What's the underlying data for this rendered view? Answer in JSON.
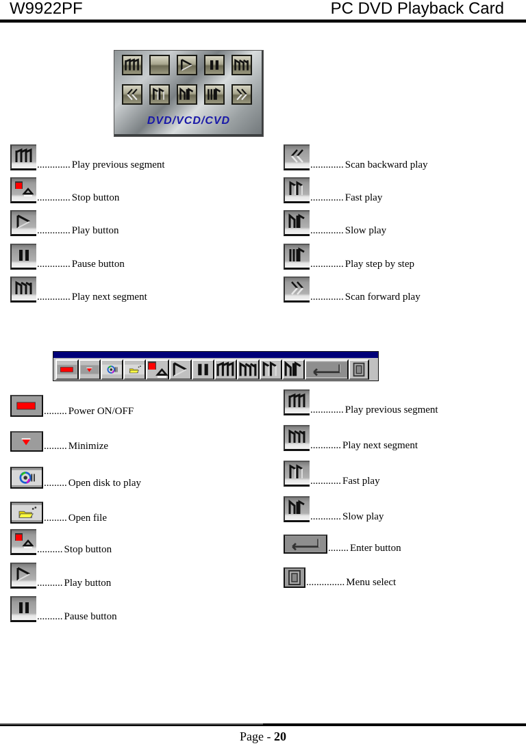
{
  "header": {
    "model": "W9922PF",
    "title": "PC DVD Playback Card"
  },
  "remote": {
    "label": "DVD/VCD/CVD",
    "buttons_row1": [
      "prev-segment-icon",
      "stop-eject-icon",
      "play-icon",
      "pause-icon",
      "next-segment-icon"
    ],
    "buttons_row2": [
      "scan-backward-icon",
      "fast-play-icon",
      "slow-play-icon",
      "step-play-icon",
      "scan-forward-icon"
    ]
  },
  "remote_legend": {
    "left": [
      {
        "icon": "prev-segment-icon",
        "dots": ".............",
        "label": "Play previous segment"
      },
      {
        "icon": "stop-icon",
        "dots": ".............",
        "label": "Stop button"
      },
      {
        "icon": "play-icon",
        "dots": ".............",
        "label": "Play button"
      },
      {
        "icon": "pause-icon",
        "dots": ".............",
        "label": "Pause button"
      },
      {
        "icon": "next-segment-icon",
        "dots": ".............",
        "label": "Play next segment"
      }
    ],
    "right": [
      {
        "icon": "scan-backward-icon",
        "dots": ".............",
        "label": "Scan backward play"
      },
      {
        "icon": "fast-play-icon",
        "dots": ".............",
        "label": "Fast play"
      },
      {
        "icon": "slow-play-icon",
        "dots": ".............",
        "label": "Slow play"
      },
      {
        "icon": "step-play-icon",
        "dots": ".............",
        "label": "Play step by step"
      },
      {
        "icon": "scan-forward-icon",
        "dots": ".............",
        "label": "Scan forward play"
      }
    ]
  },
  "toolbar": {
    "buttons": [
      "power-icon",
      "minimize-icon",
      "open-disk-icon",
      "open-file-icon",
      "stop-icon",
      "play-icon",
      "pause-icon",
      "prev-segment-icon",
      "next-segment-icon",
      "fast-play-icon",
      "slow-play-icon",
      "enter-icon",
      "menu-icon"
    ]
  },
  "toolbar_legend": {
    "left": [
      {
        "icon": "power-icon",
        "dots": ".........",
        "label": "Power ON/OFF"
      },
      {
        "icon": "minimize-icon",
        "dots": ".........",
        "label": "Minimize"
      },
      {
        "icon": "open-disk-icon",
        "dots": ".........",
        "label": "Open disk to play"
      },
      {
        "icon": "open-file-icon",
        "dots": ".........",
        "label": "Open file"
      },
      {
        "icon": "stop-icon",
        "dots": "..........",
        "label": "Stop button"
      },
      {
        "icon": "play-icon",
        "dots": "..........",
        "label": "Play button"
      },
      {
        "icon": "pause-icon",
        "dots": "..........",
        "label": "Pause button"
      }
    ],
    "right": [
      {
        "icon": "prev-segment-icon",
        "dots": ".............",
        "label": "Play previous segment"
      },
      {
        "icon": "next-segment-icon",
        "dots": "............",
        "label": "Play next segment"
      },
      {
        "icon": "fast-play-icon",
        "dots": "............",
        "label": "Fast play"
      },
      {
        "icon": "slow-play-icon",
        "dots": "............",
        "label": "Slow play"
      },
      {
        "icon": "enter-icon",
        "dots": "........",
        "label": "Enter button"
      },
      {
        "icon": "menu-icon",
        "dots": "...............",
        "label": "Menu select"
      }
    ]
  },
  "footer": {
    "prefix": "Page - ",
    "page_number": "20"
  },
  "colors": {
    "toolbar_title_bar": "#000078",
    "remote_label": "#1818a8",
    "accent_red": "#ff0000"
  }
}
